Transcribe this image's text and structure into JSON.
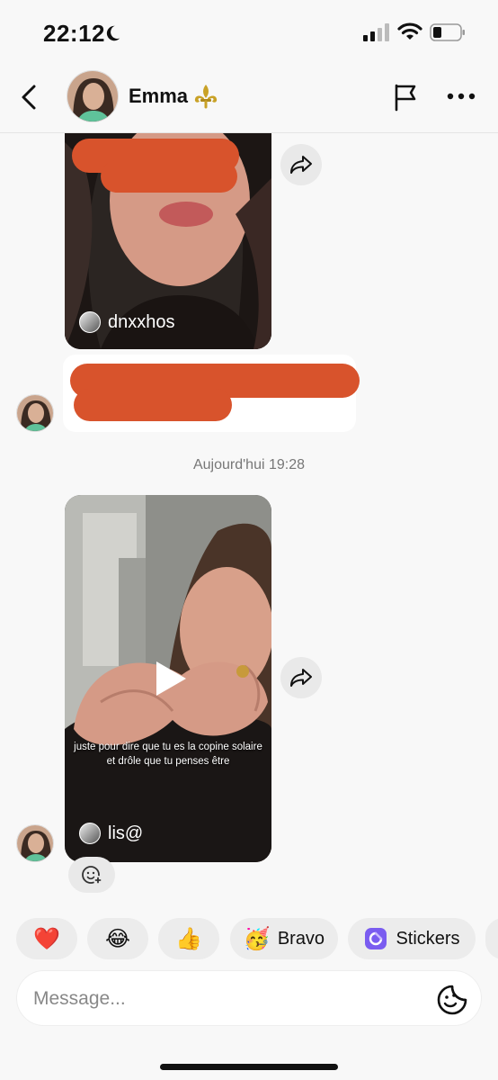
{
  "status_bar": {
    "time": "22:12"
  },
  "header": {
    "contact_name": "Emma",
    "name_emoji": "⚜️"
  },
  "messages": {
    "video1": {
      "creator": "dnxxhos"
    },
    "timestamp": "Aujourd'hui 19:28",
    "video2": {
      "creator": "lis@",
      "caption": "juste pour dire que tu es la copine solaire et drôle que tu penses être"
    }
  },
  "quick_replies": [
    {
      "emoji": "❤️",
      "label": ""
    },
    {
      "emoji": "😂",
      "label": ""
    },
    {
      "emoji": "👍",
      "label": ""
    },
    {
      "emoji": "🥳",
      "label": "Bravo"
    },
    {
      "emoji": "🟣",
      "label": "Stickers"
    }
  ],
  "composer": {
    "placeholder": "Message..."
  },
  "colors": {
    "redaction": "#d8532c",
    "background": "#f8f8f8"
  }
}
